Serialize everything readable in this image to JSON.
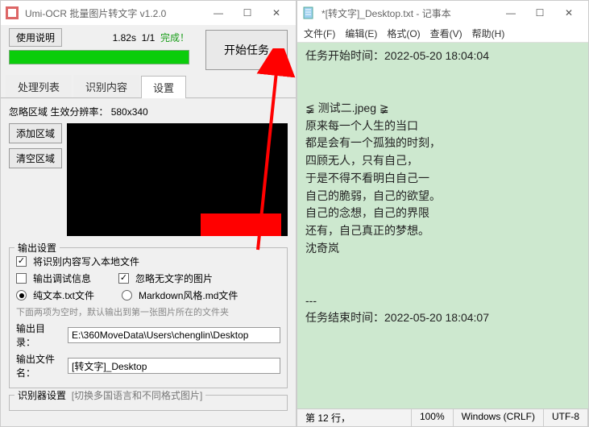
{
  "left": {
    "title": "Umi-OCR 批量图片转文字 v1.2.0",
    "usage_btn": "使用说明",
    "elapsed": "1.82s",
    "progress": "1/1",
    "done": "完成！",
    "start_btn": "开始任务",
    "tabs": {
      "queue": "处理列表",
      "content": "识别内容",
      "settings": "设置"
    },
    "ignore": {
      "label": "忽略区域 生效分辨率：",
      "resolution": "580x340",
      "add_btn": "添加区域",
      "clear_btn": "清空区域"
    },
    "output": {
      "legend": "输出设置",
      "write_local": "将识别内容写入本地文件",
      "debug_info": "输出调试信息",
      "ignore_empty": "忽略无文字的图片",
      "plain_txt": "纯文本.txt文件",
      "markdown": "Markdown风格.md文件",
      "hint": "下面两项为空时，默认输出到第一张图片所在的文件夹",
      "dir_label": "输出目录：",
      "dir_value": "E:\\360MoveData\\Users\\chenglin\\Desktop",
      "name_label": "输出文件名：",
      "name_value": "[转文字]_Desktop"
    },
    "recognizer": {
      "legend": "识别器设置",
      "note": "[切换多国语言和不同格式图片]"
    }
  },
  "right": {
    "title": "*[转文字]_Desktop.txt - 记事本",
    "menu": {
      "file": "文件(F)",
      "edit": "编辑(E)",
      "format": "格式(O)",
      "view": "查看(V)",
      "help": "帮助(H)"
    },
    "body": "任务开始时间：2022-05-20 18:04:04\n\n\n≨ 测试二.jpeg ≩\n原来每一个人生的当口\n都是会有一个孤独的时刻，\n四顾无人，只有自己，\n于是不得不看明白自己一\n自己的脆弱，自己的欲望。\n自己的念想，自己的界限\n还有，自己真正的梦想。\n沈奇岚\n\n\n---\n任务结束时间：2022-05-20 18:04:07",
    "status": {
      "pos": "第 12 行，",
      "zoom": "100%",
      "eol": "Windows (CRLF)",
      "enc": "UTF-8"
    }
  },
  "winbtns": {
    "min": "—",
    "max": "☐",
    "close": "✕"
  }
}
